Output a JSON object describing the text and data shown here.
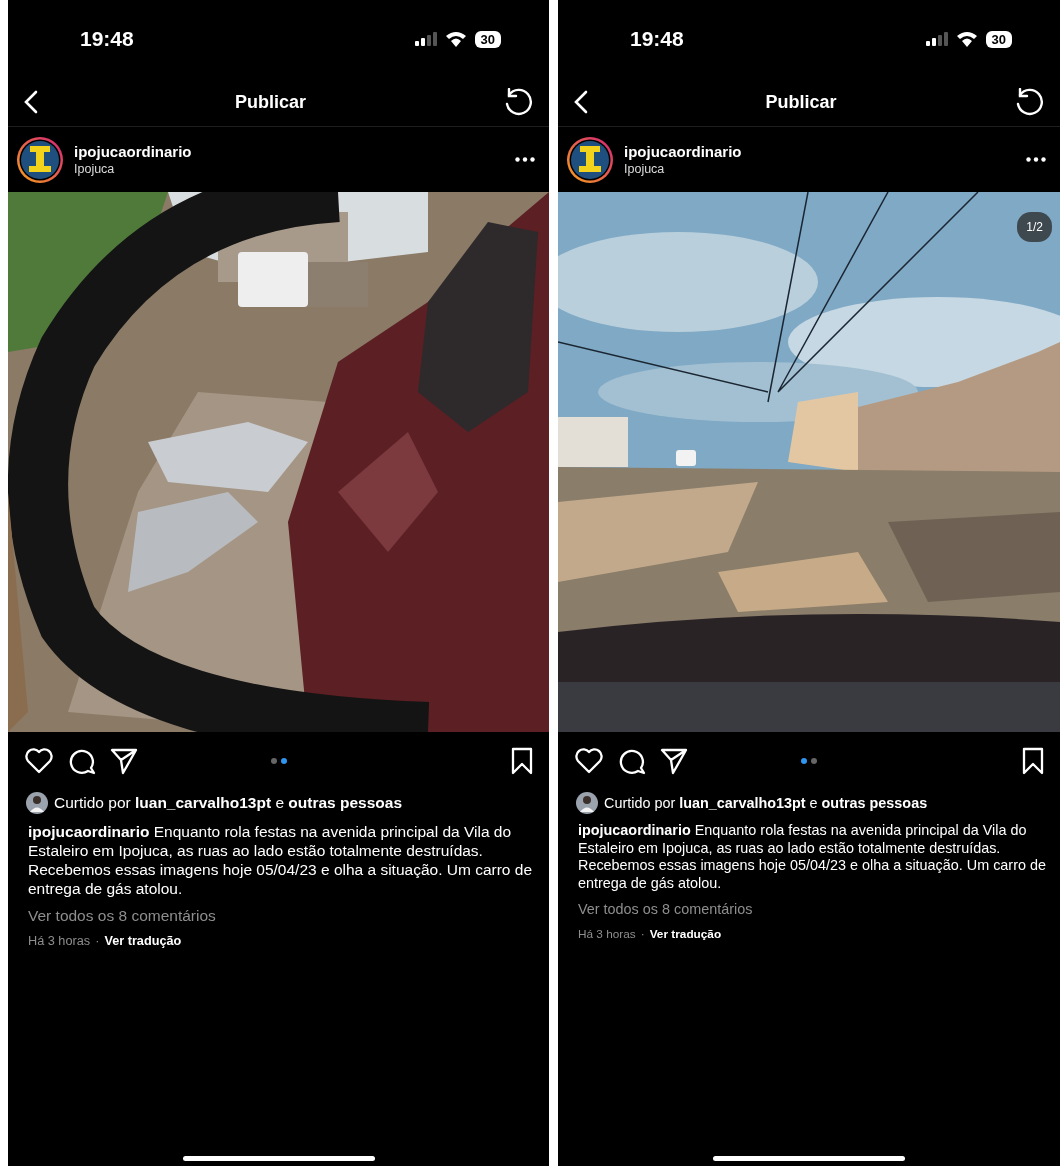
{
  "screens": [
    {
      "status_bar": {
        "time": "19:48",
        "battery": "30"
      },
      "nav": {
        "title": "Publicar"
      },
      "post": {
        "username": "ipojucaordinario",
        "location": "Ipojuca",
        "page_dots": [
          {
            "selected": false
          },
          {
            "selected": true
          }
        ],
        "liked_by": "Curtido por **luan_carvalho13pt** e **outras pessoas**",
        "caption": "**ipojucaordinario** Enquanto rola festas na avenida principal da Vila do Estaleiro em Ipojuca, as ruas ao lado estão totalmente destruídas. Recebemos essas imagens hoje 05/04/23 e olha a situação. Um carro de entrega de gás atolou.",
        "comments_link": "Ver todos os 8 comentários",
        "time_ago": "Há 3 horas",
        "separator": "·",
        "translate_link": "Ver tradução"
      }
    },
    {
      "status_bar": {
        "time": "19:48",
        "battery": "30"
      },
      "nav": {
        "title": "Publicar"
      },
      "post": {
        "username": "ipojucaordinario",
        "location": "Ipojuca",
        "photo_counter": "1/2",
        "page_dots": [
          {
            "selected": true
          },
          {
            "selected": false
          }
        ],
        "liked_by": "Curtido por **luan_carvalho13pt** e **outras pessoas**",
        "caption": "**ipojucaordinario** Enquanto rola festas na avenida principal da Vila do Estaleiro em Ipojuca, as ruas ao lado estão totalmente destruídas. Recebemos essas imagens hoje 05/04/23 e olha a situação. Um carro de entrega de gás atolou.",
        "comments_link": "Ver todos os 8 comentários",
        "time_ago": "Há 3 horas",
        "separator": "·",
        "translate_link": "Ver tradução"
      }
    }
  ]
}
